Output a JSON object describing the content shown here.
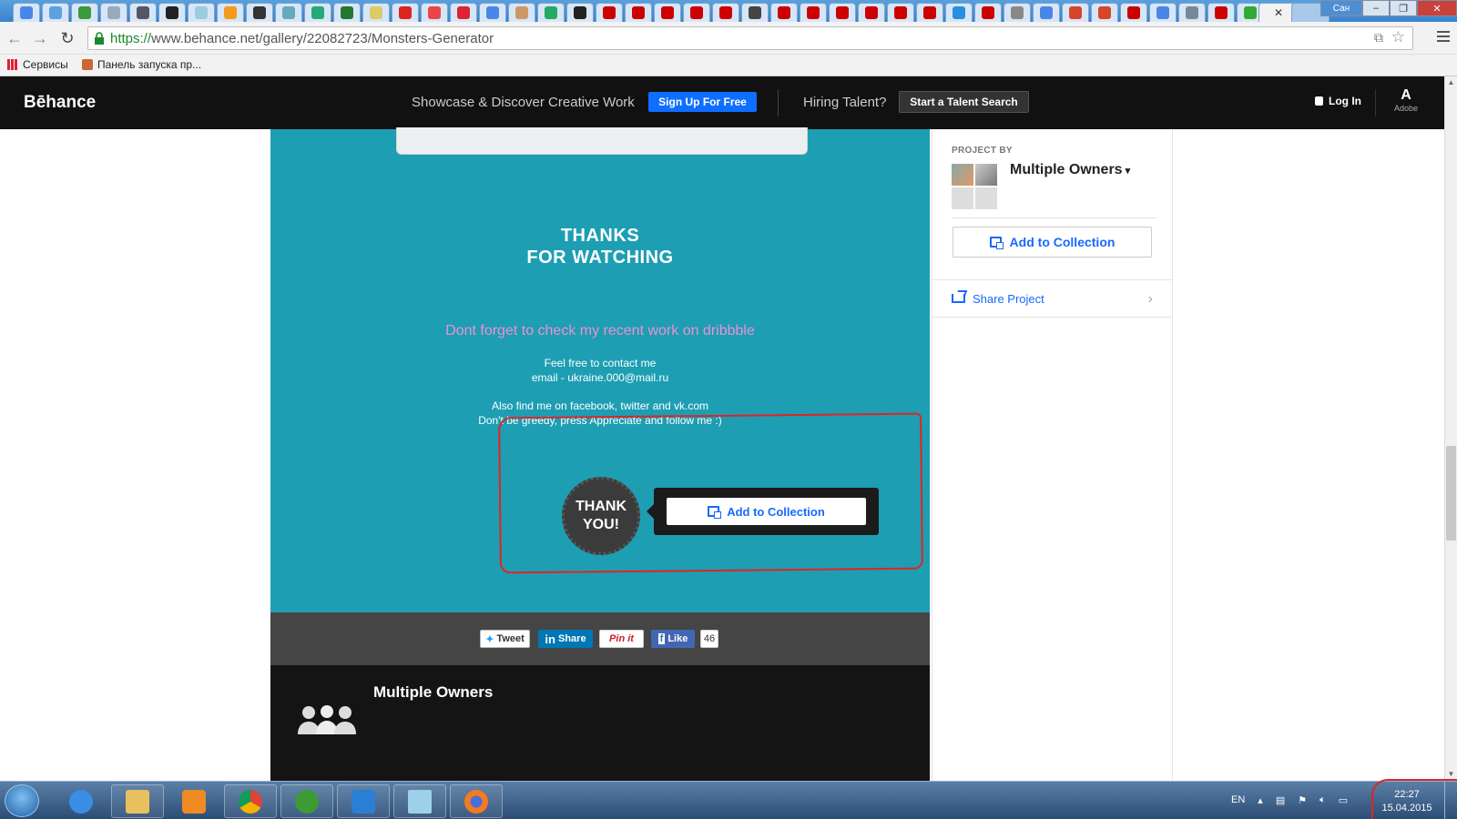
{
  "browser": {
    "url_https": "https://",
    "url_rest": "www.behance.net/gallery/22082723/Monsters-Generator",
    "bookmarks": [
      "Сервисы",
      "Панель запуска пр..."
    ],
    "window_user": "Сан"
  },
  "header": {
    "logo": "Bēhance",
    "tagline": "Showcase & Discover Creative Work",
    "signup": "Sign Up For Free",
    "hiring": "Hiring Talent?",
    "talent_search": "Start a Talent Search",
    "login": "Log In",
    "adobe": "Adobe"
  },
  "project": {
    "thanks_line1": "THANKS",
    "thanks_line2": "FOR WATCHING",
    "dribbble": "Dont forget to check my recent work on dribbble",
    "contact_line1": "Feel free to contact me",
    "contact_line2": "email - ukraine.000@mail.ru",
    "find_line1": "Also find me on facebook, twitter and vk.com",
    "find_line2": "Don't be greedy, press Appreciate and follow me :)",
    "badge_line1": "THANK",
    "badge_line2": "YOU!",
    "add_to_collection": "Add to Collection"
  },
  "share": {
    "tweet": "Tweet",
    "linkedin": "Share",
    "pinit": "Pin it",
    "like": "Like",
    "like_count": "46"
  },
  "owners": {
    "name": "Multiple Owners"
  },
  "sidebar": {
    "project_by": "PROJECT BY",
    "owner": "Multiple Owners",
    "add_to_collection": "Add to Collection",
    "share_project": "Share Project"
  },
  "taskbar": {
    "lang": "EN",
    "time": "22:27",
    "date": "15.04.2015"
  },
  "colors": {
    "project_bg": "#1d9eb3",
    "accent_blue": "#1769ff",
    "signup_blue": "#0e6eff",
    "annotation_red": "#e02424",
    "dribbble_pink": "#ee8fd6"
  }
}
